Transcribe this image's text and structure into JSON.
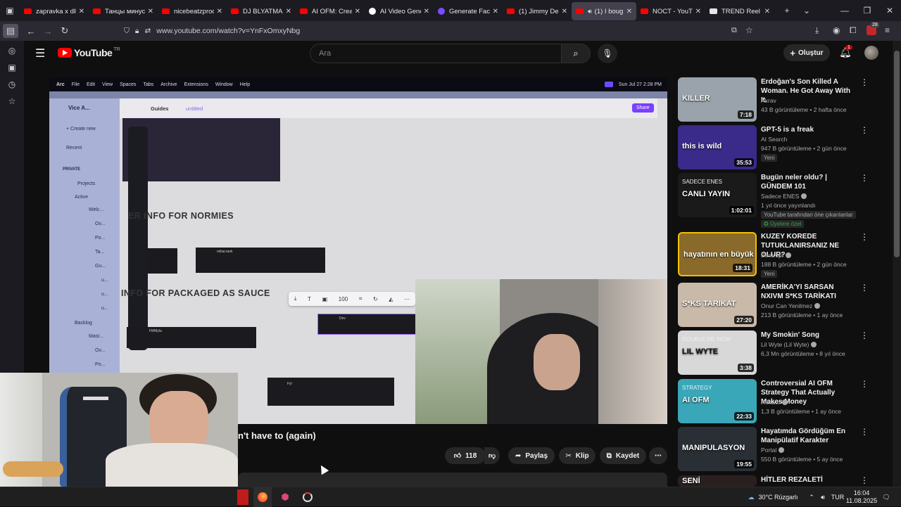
{
  "browser": {
    "tabs": [
      {
        "title": "zapravka x dlb - YouTube",
        "favicon": "youtube-icon"
      },
      {
        "title": "Танцы минус - YouTube",
        "favicon": "youtube-icon"
      },
      {
        "title": "nicebeatzprod-np - YouTube",
        "favicon": "youtube-icon"
      },
      {
        "title": "DJ BLYATMAN - YouTube",
        "favicon": "youtube-icon"
      },
      {
        "title": "AI OFM: Create an AI",
        "favicon": "youtube-icon"
      },
      {
        "title": "AI Video Generator",
        "favicon": "ai-icon"
      },
      {
        "title": "Generate Face | AI",
        "favicon": "face-icon"
      },
      {
        "title": "(1) Jimmy Denero",
        "favicon": "youtube-icon"
      },
      {
        "title": "(1) I bought",
        "favicon": "youtube-icon",
        "active": true
      },
      {
        "title": "NOCT - YouTube",
        "favicon": "youtube-icon"
      },
      {
        "title": "TREND Reel (Strategy)",
        "favicon": "trend-icon"
      }
    ],
    "url": "www.youtube.com/watch?v=YnFxOmxyNbg",
    "ext_badge": "28"
  },
  "youtube": {
    "logo": "YouTube",
    "region": "TR",
    "search_placeholder": "Ara",
    "create_label": "Oluştur",
    "notif_count": "1"
  },
  "video": {
    "title_visible": "n't have to (again)",
    "likes": "118",
    "share": "Paylaş",
    "clip": "Klip",
    "save": "Kaydet",
    "content": {
      "menubar": [
        "Arc",
        "File",
        "Edit",
        "View",
        "Spaces",
        "Tabs",
        "Archive",
        "Extensions",
        "Window",
        "Help"
      ],
      "clock": "Sun Jul 27  2:28 PM",
      "space_name": "Vice A...",
      "breadcrumb": "Guides",
      "breadcrumb_2": "untitled",
      "share": "Share",
      "new": "+ Create new",
      "recent": "Recent",
      "private": "PRIVATE",
      "tree": [
        "Projects",
        "Active",
        "Welc...",
        "Ov...",
        "Po...",
        "Ta...",
        "Gu...",
        "u...",
        "u...",
        "u...",
        "Backlog",
        "Mast...",
        "Ov...",
        "Po..."
      ],
      "heading_1": "ER INFO FOR NORMIES",
      "heading_2": "INFO FOR PACKAGED AS SAUCE",
      "zoom": "100",
      "card_names": [
        "miliacrank",
        "Dev",
        "FMMyla",
        "Fyl"
      ]
    }
  },
  "recommendations": [
    {
      "title": "Erdoğan's Son Killed A Woman. He Got Away With It.",
      "channel": "Akrav",
      "meta": "43 B görüntüleme • 2 hafta önce",
      "duration": "7:18",
      "thumb_text": "KILLER",
      "thumb_color": "#9aa3ab"
    },
    {
      "title": "GPT-5 is a freak",
      "channel": "AI Search",
      "meta": "947 B görüntüleme • 2 gün önce",
      "badge": "Yeni",
      "duration": "35:53",
      "thumb_text": "this is wild",
      "thumb_color": "#3a2a8a"
    },
    {
      "title": "Bugün neler oldu? | GÜNDEM 101",
      "channel": "Sadece ENES",
      "meta": "1 yıl önce yayınlandı",
      "badge": "YouTube tarafından öne çıkarılanlar",
      "member": "Üyelere özel",
      "duration": "1:02:01",
      "thumb_text": "CANLI YAYIN",
      "thumb_sub": "SADECE ENES",
      "thumb_color": "#1a1a1a"
    },
    {
      "title": "KUZEY KOREDE TUTUKLANIRSANIZ NE OLUR?",
      "channel": "Bentropi",
      "meta": "188 B görüntüleme • 2 gün önce",
      "badge": "Yeni",
      "duration": "18:31",
      "thumb_text": "hayatının en büyük hatası",
      "thumb_color": "#8a6a2a"
    },
    {
      "title": "AMERİKA'YI SARSAN NXIVM S*KS TARİKATI",
      "channel": "Onur Can Yenilmez",
      "meta": "213 B görüntüleme • 1 ay önce",
      "duration": "27:20",
      "thumb_text": "S*KS TARIKAT",
      "thumb_color": "#c9b9a9"
    },
    {
      "title": "My Smokin' Song",
      "channel": "Lil Wyte (Lil Wyte)",
      "meta": "6,3 Mn görüntüleme • 8 yıl önce",
      "duration": "3:38",
      "thumb_text": "LIL WYTE",
      "thumb_sub": "DOUBLE ME NOW",
      "thumb_color": "#d8d8d8"
    },
    {
      "title": "Controversial AI OFM Strategy That Actually Makes Money",
      "channel": "Renato",
      "meta": "1,3 B görüntüleme • 1 ay önce",
      "duration": "22:33",
      "thumb_text": "AI OFM",
      "thumb_sub": "STRATEGY",
      "thumb_color": "#3aa7b8"
    },
    {
      "title": "Hayatımda Gördüğüm En Manipülatif Karakter",
      "channel": "Portal",
      "meta": "550 B görüntüleme • 5 ay önce",
      "duration": "19:55",
      "thumb_text": "MANIPULASYON",
      "thumb_color": "#2a2f35"
    },
    {
      "title": "HİTLER REZALETİ",
      "channel": "",
      "meta": "",
      "thumb_text": "SENİ",
      "thumb_color": "#2a2020"
    }
  ],
  "taskbar": {
    "weather": "30°C  Rüzgarlı",
    "lang": "TUR",
    "time": "16:04",
    "date": "11.08.2025"
  }
}
